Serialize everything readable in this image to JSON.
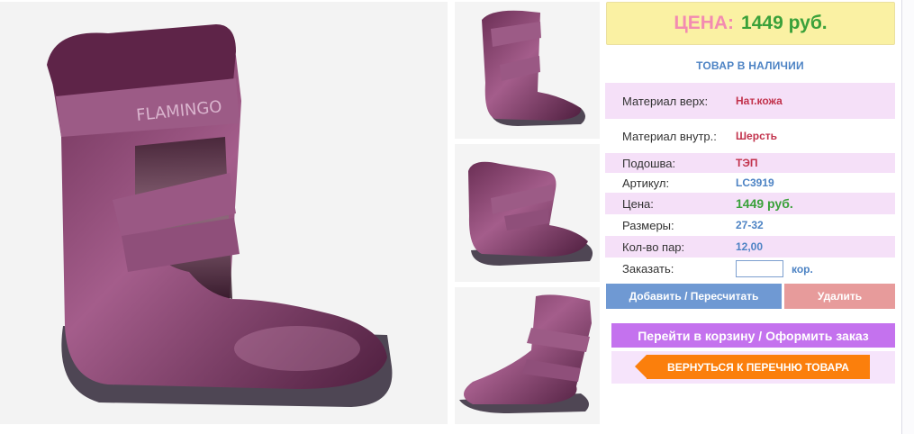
{
  "product": {
    "brand_on_boot": "FLAMINGO",
    "price_banner": {
      "label": "ЦЕНА:",
      "value": "1449 руб."
    },
    "stock_status": "ТОВАР В НАЛИЧИИ",
    "specs": [
      {
        "label": "Материал верх:",
        "value": "Нат.кожа"
      },
      {
        "label": "Материал внутр.:",
        "value": "Шерсть"
      },
      {
        "label": "Подошва:",
        "value": "ТЭП"
      },
      {
        "label": "Артикул:",
        "value": "LC3919"
      },
      {
        "label": "Цена:",
        "value": "1449 руб."
      },
      {
        "label": "Размеры:",
        "value": "27-32"
      },
      {
        "label": "Кол-во пар:",
        "value": "12,00"
      }
    ],
    "order": {
      "label": "Заказать:",
      "value": "",
      "unit": "кор."
    }
  },
  "buttons": {
    "add": "Добавить / Пересчитать",
    "delete": "Удалить",
    "cart": "Перейти в корзину / Оформить заказ",
    "back": "ВЕРНУТЬСЯ К ПЕРЕЧНЮ ТОВАРА"
  },
  "colors": {
    "boot": "#8c4b73",
    "price_label": "#f38bb1",
    "price_value": "#3aa13a",
    "link_blue": "#4d83c4",
    "btn_add": "#6f99d3",
    "btn_delete": "#e79b9b",
    "btn_cart": "#c472ee",
    "btn_back": "#fb7f0c"
  }
}
